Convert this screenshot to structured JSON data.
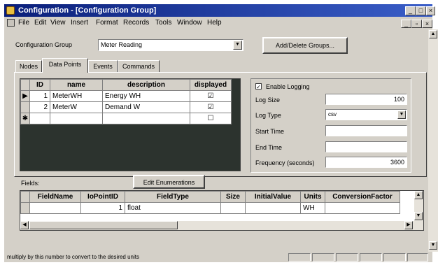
{
  "window": {
    "title": "Configuration - [Configuration Group]",
    "title_buttons": [
      "_",
      "□",
      "×"
    ],
    "doc_buttons": [
      "_",
      "▫",
      "×"
    ]
  },
  "menu": [
    "File",
    "Edit",
    "View",
    "Insert",
    "Format",
    "Records",
    "Tools",
    "Window",
    "Help"
  ],
  "config_group": {
    "label": "Configuration Group",
    "value": "Meter Reading",
    "add_delete_button": "Add/Delete Groups..."
  },
  "tabs": [
    "Nodes",
    "Data Points",
    "Events",
    "Commands"
  ],
  "data_points": {
    "columns": [
      "ID",
      "name",
      "description",
      "displayed"
    ],
    "rows": [
      {
        "selector": "▶",
        "id": "1",
        "name": "MeterWH",
        "description": "Energy WH",
        "displayed": "☑"
      },
      {
        "selector": "",
        "id": "2",
        "name": "MeterW",
        "description": "Demand W",
        "displayed": "☑"
      },
      {
        "selector": "✱",
        "id": "",
        "name": "",
        "description": "",
        "displayed": "☐"
      }
    ]
  },
  "logging": {
    "enable_label": "Enable Logging",
    "enable_checked": "✓",
    "log_size_label": "Log Size",
    "log_size_value": "100",
    "log_type_label": "Log Type",
    "log_type_value": "csv",
    "start_time_label": "Start Time",
    "start_time_value": "",
    "end_time_label": "End Time",
    "end_time_value": "",
    "frequency_label": "Frequency (seconds)",
    "frequency_value": "3600"
  },
  "fields": {
    "label": "Fields:",
    "edit_enumerations_button": "Edit Enumerations",
    "columns": [
      "FieldName",
      "IoPointID",
      "FieldType",
      "Size",
      "InitialValue",
      "Units",
      "ConversionFactor"
    ],
    "rows": [
      {
        "field_name": "",
        "io_point_id": "1",
        "field_type": "float",
        "size": "",
        "initial_value": "",
        "units": "WH",
        "conversion_factor": ""
      }
    ]
  },
  "status": {
    "text": "multiply by this number to convert to the desired units"
  },
  "colors": {
    "titlebar_start": "#0a1f7a",
    "titlebar_end": "#3a5ec8",
    "face": "#d4d0c8",
    "grid_dark": "#2c332e"
  }
}
